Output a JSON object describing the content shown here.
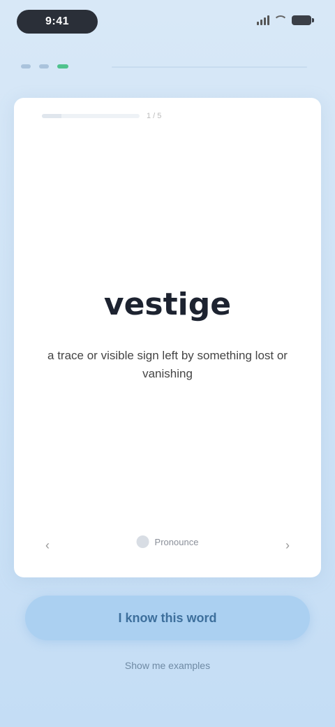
{
  "status": {
    "time": "9:41"
  },
  "nav": {
    "steps_total": 3,
    "step_active": 3
  },
  "card": {
    "counter": "1 / 5",
    "word": "vestige",
    "definition": "a trace or visible sign left by something lost or vanishing",
    "speak_label": "Pronounce",
    "prev_icon": "chevron-left-icon",
    "next_icon": "chevron-right-icon"
  },
  "actions": {
    "primary_label": "I know this word",
    "secondary_label": "Show me examples"
  },
  "colors": {
    "accent": "#4fc28d",
    "cta_bg": "#abd0f1",
    "page_bg": "#d8e8f7"
  }
}
